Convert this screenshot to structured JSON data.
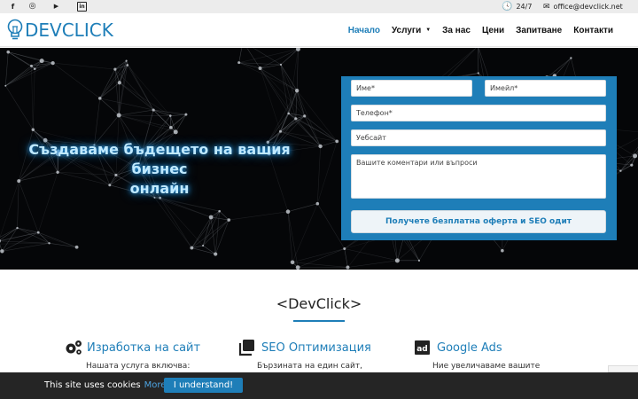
{
  "topbar": {
    "social": [
      {
        "name": "facebook-icon",
        "glyph": "f"
      },
      {
        "name": "instagram-icon",
        "glyph": "◎"
      },
      {
        "name": "youtube-icon",
        "glyph": "▶"
      },
      {
        "name": "linkedin-icon",
        "glyph": "in"
      }
    ],
    "hours": "24/7",
    "email": "office@devclick.net"
  },
  "header": {
    "logo_text": "DEVCLICK",
    "nav": [
      {
        "label": "Начало",
        "active": true
      },
      {
        "label": "Услуги",
        "has_caret": true
      },
      {
        "label": "За нас"
      },
      {
        "label": "Цени"
      },
      {
        "label": "Запитване"
      },
      {
        "label": "Контакти"
      }
    ]
  },
  "hero": {
    "title_line1": "Създаваме бъдещето на вашия бизнес",
    "title_line2": "онлайн"
  },
  "form": {
    "name_placeholder": "Име*",
    "email_placeholder": "Имейл*",
    "phone_placeholder": "Телефон*",
    "website_placeholder": "Уебсайт",
    "comments_placeholder": "Вашите коментари или въпроси",
    "submit_label": "Получете безплатна оферта и SEO одит"
  },
  "main": {
    "section_title": "<DevClick>",
    "services": [
      {
        "title": "Изработка на сайт",
        "icon": "gears-icon",
        "desc": "Нашата услуга включва:"
      },
      {
        "title": "SEO Оптимизация",
        "icon": "copy-icon",
        "desc": "Бързината на един сайт,"
      },
      {
        "title": "Google Ads",
        "icon": "ad-icon",
        "desc": "Ние увеличаваме вашите"
      }
    ]
  },
  "cookie": {
    "message": "This site uses cookies",
    "more": "More",
    "button": "I understand!"
  },
  "colors": {
    "accent": "#1e7eb8",
    "topbar_bg": "#ececec",
    "hero_bg": "#050608",
    "cookie_bg": "#252525"
  }
}
